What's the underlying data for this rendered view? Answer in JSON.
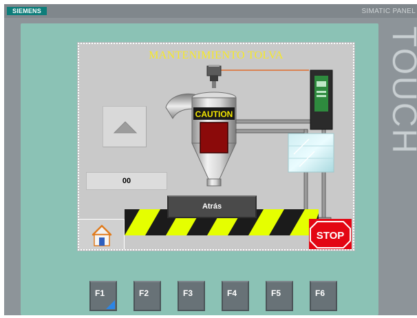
{
  "device": {
    "brand": "SIEMENS",
    "model": "SIMATIC PANEL",
    "vertical_label": "TOUCH"
  },
  "screen": {
    "title": "MANTENIMIENTO TOLVA",
    "caution_label": "CAUTION",
    "counter_value": "00",
    "back_button_label": "Atrás",
    "stop_label": "STOP"
  },
  "function_keys": [
    "F1",
    "F2",
    "F3",
    "F4",
    "F5",
    "F6"
  ],
  "colors": {
    "title": "#f6e928",
    "hazard_yellow": "#e5ff00",
    "stop_red": "#e30613",
    "bezel": "#8bc2b5"
  }
}
